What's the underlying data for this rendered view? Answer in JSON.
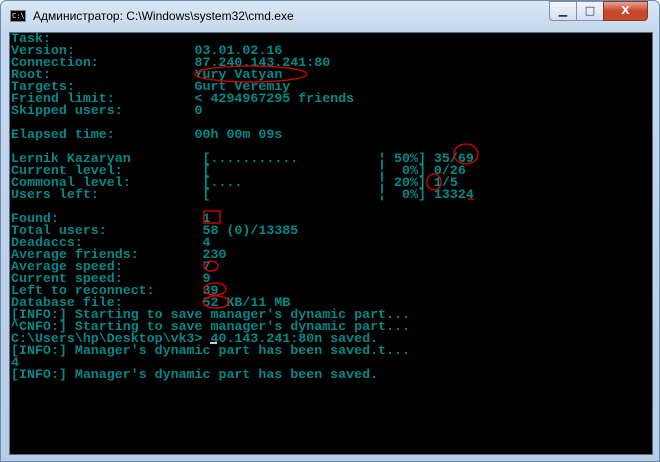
{
  "window": {
    "title": "Администратор: C:\\Windows\\system32\\cmd.exe",
    "icon": "cmd-icon",
    "buttons": {
      "minimize": "▁",
      "maximize": "□",
      "close": "X"
    }
  },
  "console": {
    "text_color": "#008a8a",
    "lines": [
      "Task:",
      "Version:               03.01.02.16",
      "Connection:            87.240.143.241:80",
      "Root:                  Yury Vatyan",
      "Targets:               Gurt Veremiy",
      "Friend limit:          < 4294967295 friends",
      "Skipped users:         0",
      "",
      "Elapsed time:          00h 00m 09s",
      "",
      "Lernik Kazaryan         [...........          ¦ 50%] 35/69",
      "Current level:          [                     ¦  0%] 0/26",
      "Commonal level:         [....                 ¦ 20%] 1/5",
      "Users left:             [                     ¦  0%] 13324",
      "",
      "Found:                  1",
      "Total users:            58 (0)/13385",
      "Deadaccs:               4",
      "Average friends:        230",
      "Average speed:          7",
      "Current speed:          9",
      "Left to reconnect:      39",
      "Database file:          52 KB/11 MB",
      "[INFO:] Starting to save manager's dynamic part...",
      "^CNFO:] Starting to save manager's dynamic part...",
      "C:\\Users\\hp\\Desktop\\vk3> 40.143.241:80n saved.",
      "[INFO:] Manager's dynamic part has been saved.t...",
      "4",
      "[INFO:] Manager's dynamic part has been saved."
    ]
  },
  "annotation_color": "#e00000"
}
